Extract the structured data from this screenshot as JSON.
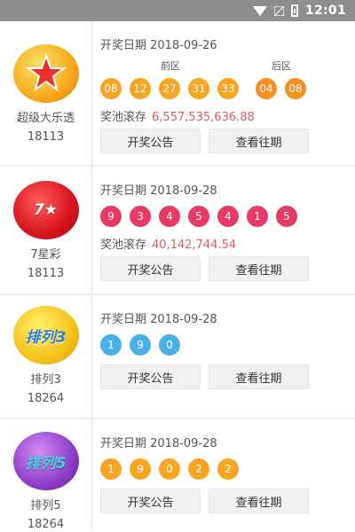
{
  "status_bar": {
    "time": "12:01"
  },
  "colors": {
    "orange": "#f6a623",
    "red": "#e73b66",
    "blue": "#49b1e8",
    "pool": "#e05b5b"
  },
  "rows": [
    {
      "name": "超级大乐透",
      "issue": "18113",
      "date": "开奖日期 2018-09-26",
      "front_label": "前区",
      "back_label": "后区",
      "front_balls": [
        "08",
        "12",
        "27",
        "31",
        "33"
      ],
      "back_balls": [
        "04",
        "08"
      ],
      "pool_label": "奖池滚存",
      "pool_value": "6,557,535,636.88",
      "btn_announce": "开奖公告",
      "btn_history": "查看往期"
    },
    {
      "name": "7星彩",
      "issue": "18113",
      "date": "开奖日期 2018-09-28",
      "balls": [
        "9",
        "3",
        "4",
        "5",
        "4",
        "1",
        "5"
      ],
      "pool_label": "奖池滚存",
      "pool_value": "40,142,744.54",
      "btn_announce": "开奖公告",
      "btn_history": "查看往期"
    },
    {
      "name": "排列3",
      "issue": "18264",
      "date": "开奖日期 2018-09-28",
      "balls": [
        "1",
        "9",
        "0"
      ],
      "btn_announce": "开奖公告",
      "btn_history": "查看往期"
    },
    {
      "name": "排列5",
      "issue": "18264",
      "date": "开奖日期 2018-09-28",
      "balls": [
        "1",
        "9",
        "0",
        "2",
        "2"
      ],
      "btn_announce": "开奖公告",
      "btn_history": "查看往期"
    }
  ]
}
